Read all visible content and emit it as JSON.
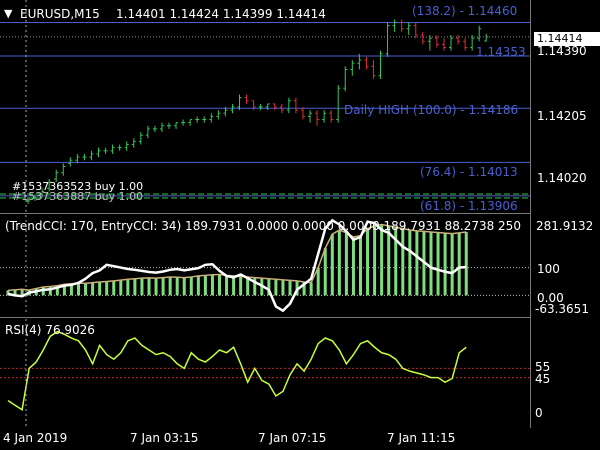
{
  "header": {
    "symbol_timeframe": "EURUSD,M15",
    "ohlc": "1.14401 1.14424 1.14399 1.14414",
    "menu_glyph": "▼"
  },
  "colors": {
    "background": "#000000",
    "bull": "#34c759",
    "bear": "#e03030",
    "level_line": "#4a5fd0",
    "cci_line": "#ffffff",
    "cci_hist": "#7fdc7f",
    "cci_signal": "#c8b078",
    "rsi_line": "#c6ff3a",
    "rsi_level": "#c02020"
  },
  "main": {
    "current_price": "1.14414",
    "price_axis": [
      "1.14390",
      "1.14205",
      "1.14020"
    ],
    "fib_levels": [
      {
        "label": "(138.2) - 1.14460"
      },
      {
        "label": "1.14353"
      },
      {
        "label": "Daily HIGH (100.0) - 1.14186"
      },
      {
        "label": "(76.4) - 1.14013"
      },
      {
        "label": "(61.8) - 1.13906"
      }
    ],
    "order_labels": [
      "#1537363523 buy 1.00",
      "#1537363887 buy 1.00"
    ],
    "candles": [
      [
        1.1389,
        1.139,
        1.1388,
        1.1389
      ],
      [
        1.139,
        1.1391,
        1.1389,
        1.139
      ],
      [
        1.1391,
        1.1393,
        1.139,
        1.1392
      ],
      [
        1.1393,
        1.1396,
        1.1392,
        1.1395
      ],
      [
        1.1396,
        1.1399,
        1.1395,
        1.1398
      ],
      [
        1.1398,
        1.1401,
        1.1397,
        1.14
      ],
      [
        1.1401,
        1.1403,
        1.14,
        1.1402
      ],
      [
        1.1402,
        1.1404,
        1.1401,
        1.1403
      ],
      [
        1.1403,
        1.1404,
        1.1402,
        1.1403
      ],
      [
        1.1403,
        1.1405,
        1.1402,
        1.1404
      ],
      [
        1.1404,
        1.1406,
        1.1403,
        1.1405
      ],
      [
        1.1405,
        1.1406,
        1.1404,
        1.1405
      ],
      [
        1.1405,
        1.1407,
        1.1404,
        1.1406
      ],
      [
        1.1406,
        1.1407,
        1.1405,
        1.1406
      ],
      [
        1.1406,
        1.1408,
        1.1405,
        1.1407
      ],
      [
        1.1407,
        1.1409,
        1.1406,
        1.1408
      ],
      [
        1.1408,
        1.1411,
        1.1407,
        1.141
      ],
      [
        1.141,
        1.1413,
        1.1409,
        1.1412
      ],
      [
        1.1412,
        1.1413,
        1.1411,
        1.1412
      ],
      [
        1.1412,
        1.1414,
        1.1411,
        1.1413
      ],
      [
        1.1413,
        1.1414,
        1.1412,
        1.1413
      ],
      [
        1.1413,
        1.1414,
        1.1412,
        1.1414
      ],
      [
        1.1414,
        1.1415,
        1.1413,
        1.1414
      ],
      [
        1.1414,
        1.1415,
        1.1413,
        1.1415
      ],
      [
        1.1415,
        1.1416,
        1.1414,
        1.1415
      ],
      [
        1.1415,
        1.1416,
        1.1414,
        1.1415
      ],
      [
        1.1415,
        1.1417,
        1.1414,
        1.1416
      ],
      [
        1.1416,
        1.1418,
        1.1415,
        1.1417
      ],
      [
        1.1417,
        1.1419,
        1.1416,
        1.1418
      ],
      [
        1.1418,
        1.142,
        1.1417,
        1.1419
      ],
      [
        1.1419,
        1.1423,
        1.1418,
        1.1422
      ],
      [
        1.1422,
        1.1423,
        1.142,
        1.1421
      ],
      [
        1.1421,
        1.1421,
        1.1418,
        1.1419
      ],
      [
        1.1419,
        1.142,
        1.1418,
        1.1419
      ],
      [
        1.1419,
        1.142,
        1.1418,
        1.142
      ],
      [
        1.142,
        1.142,
        1.1418,
        1.1419
      ],
      [
        1.1419,
        1.142,
        1.1417,
        1.1418
      ],
      [
        1.1418,
        1.1422,
        1.1417,
        1.1421
      ],
      [
        1.1421,
        1.1422,
        1.1417,
        1.1418
      ],
      [
        1.1418,
        1.1419,
        1.1415,
        1.1416
      ],
      [
        1.1416,
        1.1418,
        1.1414,
        1.1417
      ],
      [
        1.1417,
        1.1418,
        1.1413,
        1.1415
      ],
      [
        1.1415,
        1.1418,
        1.1414,
        1.1417
      ],
      [
        1.1417,
        1.1418,
        1.1414,
        1.1415
      ],
      [
        1.1415,
        1.1426,
        1.1414,
        1.1425
      ],
      [
        1.1425,
        1.1432,
        1.1424,
        1.1431
      ],
      [
        1.1431,
        1.1434,
        1.1429,
        1.1433
      ],
      [
        1.1433,
        1.1436,
        1.1431,
        1.1434
      ],
      [
        1.1434,
        1.1435,
        1.1431,
        1.1432
      ],
      [
        1.1432,
        1.1434,
        1.1428,
        1.1429
      ],
      [
        1.1429,
        1.1437,
        1.1428,
        1.1436
      ],
      [
        1.1436,
        1.1446,
        1.1435,
        1.1445
      ],
      [
        1.1445,
        1.1447,
        1.1443,
        1.1446
      ],
      [
        1.1446,
        1.1447,
        1.1443,
        1.1444
      ],
      [
        1.1444,
        1.1446,
        1.1442,
        1.1445
      ],
      [
        1.1445,
        1.1446,
        1.1441,
        1.1442
      ],
      [
        1.1442,
        1.1443,
        1.1439,
        1.144
      ],
      [
        1.144,
        1.1442,
        1.1437,
        1.1441
      ],
      [
        1.1441,
        1.1442,
        1.1438,
        1.1439
      ],
      [
        1.1439,
        1.1441,
        1.1437,
        1.1438
      ],
      [
        1.1438,
        1.1442,
        1.1437,
        1.1441
      ],
      [
        1.1441,
        1.1442,
        1.1439,
        1.144
      ],
      [
        1.144,
        1.1441,
        1.1437,
        1.1438
      ],
      [
        1.1438,
        1.1442,
        1.1437,
        1.1441
      ],
      [
        1.1441,
        1.1445,
        1.144,
        1.1444
      ],
      [
        1.14401,
        1.14424,
        1.14399,
        1.14414
      ]
    ]
  },
  "cci": {
    "label": "(TrendCCI: 170, EntryCCI: 34)  189.7931 0.0000 0.0000 0.0000 189.7931 88.2738 250",
    "right_top_value": "281.9132",
    "axis": [
      "100",
      "0.00",
      "-63.3651"
    ],
    "zero_label": "0.00",
    "hist": [
      18,
      20,
      22,
      19,
      25,
      30,
      32,
      35,
      40,
      42,
      44,
      43,
      46,
      48,
      50,
      52,
      55,
      58,
      60,
      62,
      63,
      62,
      64,
      66,
      65,
      64,
      66,
      70,
      72,
      74,
      75,
      72,
      70,
      68,
      66,
      64,
      62,
      60,
      58,
      56,
      54,
      52,
      48,
      46,
      100,
      170,
      220,
      235,
      225,
      210,
      215,
      240,
      250,
      255,
      250,
      245,
      240,
      235,
      232,
      230,
      228,
      226,
      224,
      222,
      225,
      228
    ],
    "signal": [
      18,
      20,
      22,
      19,
      25,
      30,
      32,
      35,
      40,
      42,
      44,
      43,
      46,
      48,
      50,
      52,
      55,
      58,
      60,
      62,
      63,
      62,
      64,
      66,
      65,
      64,
      66,
      70,
      72,
      74,
      75,
      72,
      70,
      68,
      66,
      64,
      62,
      60,
      58,
      56,
      54,
      52,
      48,
      46,
      100,
      170,
      220,
      235,
      225,
      210,
      215,
      240,
      250,
      255,
      250,
      245,
      240,
      235,
      232,
      230,
      228,
      226,
      224,
      222,
      225,
      228
    ],
    "line": [
      5,
      0,
      -3,
      10,
      15,
      20,
      22,
      28,
      35,
      38,
      45,
      60,
      80,
      90,
      110,
      105,
      100,
      95,
      92,
      88,
      84,
      82,
      86,
      92,
      95,
      90,
      94,
      98,
      110,
      112,
      88,
      70,
      65,
      75,
      62,
      48,
      35,
      20,
      -40,
      -55,
      -30,
      20,
      40,
      60,
      150,
      240,
      270,
      255,
      230,
      200,
      210,
      265,
      260,
      235,
      225,
      200,
      175,
      160,
      140,
      120,
      100,
      92,
      85,
      80,
      100,
      102
    ]
  },
  "rsi": {
    "label": "RSI(4) 76.9026",
    "axis": [
      "55",
      "45",
      "0"
    ],
    "values": [
      20,
      15,
      10,
      55,
      62,
      75,
      90,
      95,
      92,
      88,
      85,
      75,
      60,
      80,
      70,
      65,
      72,
      85,
      88,
      80,
      75,
      70,
      72,
      68,
      60,
      55,
      72,
      65,
      62,
      68,
      75,
      72,
      78,
      60,
      40,
      55,
      42,
      38,
      25,
      30,
      48,
      60,
      52,
      65,
      82,
      88,
      85,
      75,
      60,
      70,
      82,
      85,
      78,
      72,
      70,
      65,
      55,
      52,
      50,
      48,
      45,
      45,
      40,
      44,
      72,
      78
    ]
  },
  "time_axis": [
    "4 Jan 2019",
    "7 Jan 03:15",
    "7 Jan 07:15",
    "7 Jan 11:15"
  ]
}
